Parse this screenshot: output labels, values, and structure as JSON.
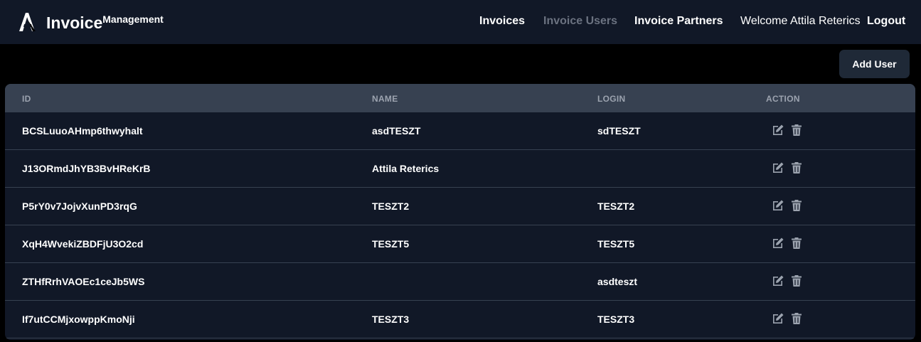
{
  "header": {
    "brand_title": "Invoice",
    "brand_sup": "Management",
    "logo_icon": "brand-logo-icon",
    "nav": {
      "invoices": "Invoices",
      "invoice_users": "Invoice Users",
      "invoice_partners": "Invoice Partners",
      "welcome": "Welcome Attila Reterics",
      "logout": "Logout"
    }
  },
  "toolbar": {
    "add_user_label": "Add User"
  },
  "table": {
    "headers": {
      "id": "ID",
      "name": "NAME",
      "login": "LOGIN",
      "action": "ACTION"
    },
    "rows": [
      {
        "id": "BCSLuuoAHmp6thwyhalt",
        "name": "asdTESZT",
        "login": "sdTESZT"
      },
      {
        "id": "J13ORmdJhYB3BvHReKrB",
        "name": "Attila Reterics",
        "login": ""
      },
      {
        "id": "P5rY0v7JojvXunPD3rqG",
        "name": "TESZT2",
        "login": "TESZT2"
      },
      {
        "id": "XqH4WvekiZBDFjU3O2cd",
        "name": "TESZT5",
        "login": "TESZT5"
      },
      {
        "id": "ZTHfRrhVAOEc1ceJb5WS",
        "name": "",
        "login": "asdteszt"
      },
      {
        "id": "If7utCCMjxowppKmoNji",
        "name": "TESZT3",
        "login": "TESZT3"
      }
    ],
    "row_actions": [
      "edit-icon",
      "trash-icon"
    ]
  },
  "colors": {
    "page_bg": "#000000",
    "navbar_bg": "#111827",
    "table_bg": "#111827",
    "table_head_bg": "#374151",
    "muted_text": "#6b7280",
    "header_text": "#9ca3af",
    "button_bg": "#1f2937",
    "icon_color": "#9ca3af"
  }
}
